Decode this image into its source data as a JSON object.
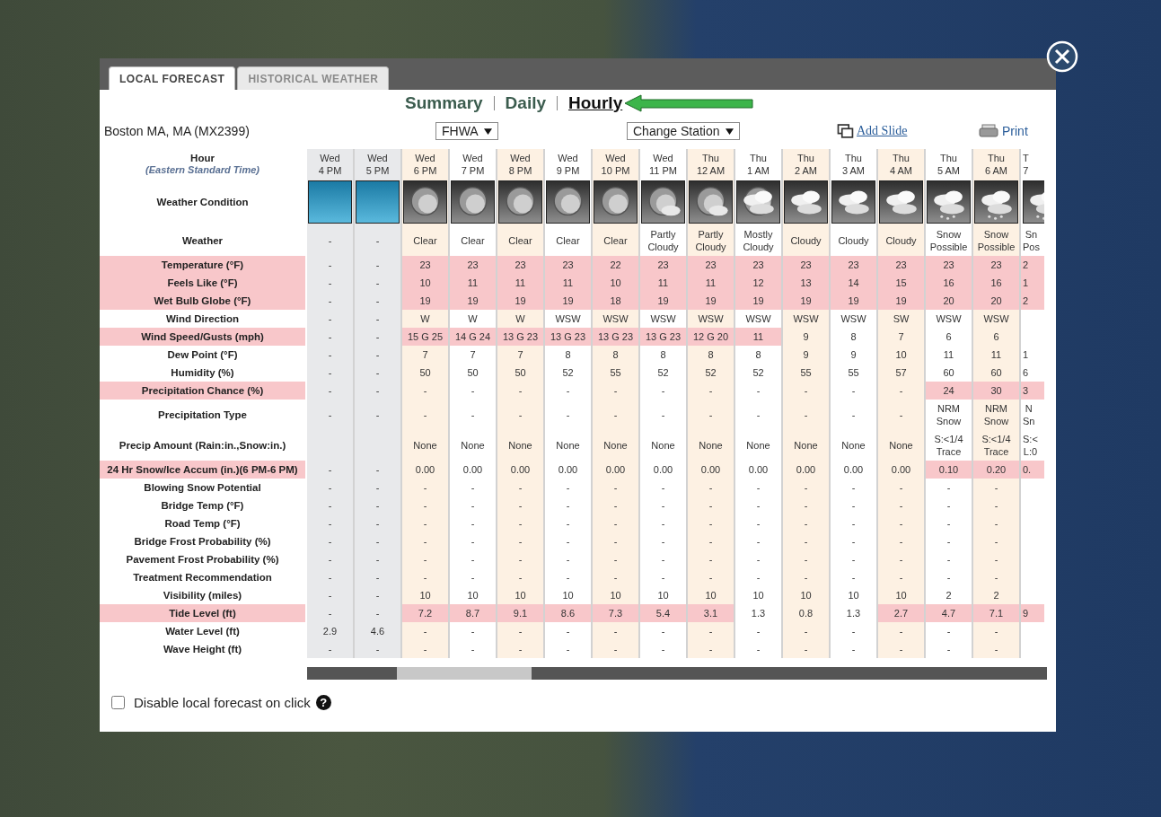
{
  "tabs": [
    {
      "label": "LOCAL FORECAST",
      "selected": true
    },
    {
      "label": "HISTORICAL WEATHER",
      "selected": false
    }
  ],
  "views": [
    {
      "label": "Summary",
      "selected": false
    },
    {
      "label": "Daily",
      "selected": false
    },
    {
      "label": "Hourly",
      "selected": true
    }
  ],
  "location": "Boston MA, MA (MX2399)",
  "source_select": {
    "value": "FHWA"
  },
  "station_select": {
    "value": "Change Station"
  },
  "add_slide": "Add Slide",
  "print": "Print",
  "table": {
    "hour_label": "Hour",
    "timezone": "(Eastern Standard Time)",
    "condition_label": "Weather Condition",
    "columns": [
      {
        "day": "Wed",
        "time": "4 PM",
        "kind": "observed"
      },
      {
        "day": "Wed",
        "time": "5 PM",
        "kind": "observed"
      },
      {
        "day": "Wed",
        "time": "6 PM",
        "kind": "clear"
      },
      {
        "day": "Wed",
        "time": "7 PM",
        "kind": "clear"
      },
      {
        "day": "Wed",
        "time": "8 PM",
        "kind": "clear"
      },
      {
        "day": "Wed",
        "time": "9 PM",
        "kind": "clear"
      },
      {
        "day": "Wed",
        "time": "10 PM",
        "kind": "clear"
      },
      {
        "day": "Wed",
        "time": "11 PM",
        "kind": "partlycloudy"
      },
      {
        "day": "Thu",
        "time": "12 AM",
        "kind": "partlycloudy"
      },
      {
        "day": "Thu",
        "time": "1 AM",
        "kind": "mostlycloudy"
      },
      {
        "day": "Thu",
        "time": "2 AM",
        "kind": "cloudy"
      },
      {
        "day": "Thu",
        "time": "3 AM",
        "kind": "cloudy"
      },
      {
        "day": "Thu",
        "time": "4 AM",
        "kind": "cloudy"
      },
      {
        "day": "Thu",
        "time": "5 AM",
        "kind": "snow"
      },
      {
        "day": "Thu",
        "time": "6 AM",
        "kind": "snow"
      },
      {
        "day": "T",
        "time": "7",
        "kind": "snow"
      }
    ],
    "rows": [
      {
        "label": "Weather",
        "alert": false,
        "cells": [
          "-",
          "-",
          "Clear",
          "Clear",
          "Clear",
          "Clear",
          "Clear",
          "Partly\nCloudy",
          "Partly\nCloudy",
          "Mostly\nCloudy",
          "Cloudy",
          "Cloudy",
          "Cloudy",
          "Snow\nPossible",
          "Snow\nPossible",
          "Sn\nPos"
        ]
      },
      {
        "label": "Temperature (°F)",
        "alert": true,
        "cells": [
          "-",
          "-",
          "23",
          "23",
          "23",
          "23",
          "22",
          "23",
          "23",
          "23",
          "23",
          "23",
          "23",
          "23",
          "23",
          "2"
        ],
        "alerts": [
          false,
          false,
          true,
          true,
          true,
          true,
          true,
          true,
          true,
          true,
          true,
          true,
          true,
          true,
          true,
          true
        ]
      },
      {
        "label": "Feels Like (°F)",
        "alert": true,
        "cells": [
          "-",
          "-",
          "10",
          "11",
          "11",
          "11",
          "10",
          "11",
          "11",
          "12",
          "13",
          "14",
          "15",
          "16",
          "16",
          "1"
        ],
        "alerts": [
          false,
          false,
          true,
          true,
          true,
          true,
          true,
          true,
          true,
          true,
          true,
          true,
          true,
          true,
          true,
          true
        ]
      },
      {
        "label": "Wet Bulb Globe (°F)",
        "alert": true,
        "cells": [
          "-",
          "-",
          "19",
          "19",
          "19",
          "19",
          "18",
          "19",
          "19",
          "19",
          "19",
          "19",
          "19",
          "20",
          "20",
          "2"
        ],
        "alerts": [
          false,
          false,
          true,
          true,
          true,
          true,
          true,
          true,
          true,
          true,
          true,
          true,
          true,
          true,
          true,
          true
        ]
      },
      {
        "label": "Wind Direction",
        "alert": false,
        "cells": [
          "-",
          "-",
          "W",
          "W",
          "W",
          "WSW",
          "WSW",
          "WSW",
          "WSW",
          "WSW",
          "WSW",
          "WSW",
          "SW",
          "WSW",
          "WSW",
          null
        ]
      },
      {
        "label": "Wind Speed/Gusts (mph)",
        "alert": true,
        "cells": [
          "-",
          "-",
          "15 G 25",
          "14 G 24",
          "13 G 23",
          "13 G 23",
          "13 G 23",
          "13 G 23",
          "12 G 20",
          "11",
          "9",
          "8",
          "7",
          "6",
          "6",
          null
        ],
        "alerts": [
          false,
          false,
          true,
          true,
          true,
          true,
          true,
          true,
          true,
          true,
          false,
          false,
          false,
          false,
          false,
          false
        ]
      },
      {
        "label": "Dew Point (°F)",
        "alert": false,
        "cells": [
          "-",
          "-",
          "7",
          "7",
          "7",
          "8",
          "8",
          "8",
          "8",
          "8",
          "9",
          "9",
          "10",
          "11",
          "11",
          "1"
        ]
      },
      {
        "label": "Humidity (%)",
        "alert": false,
        "cells": [
          "-",
          "-",
          "50",
          "50",
          "50",
          "52",
          "55",
          "52",
          "52",
          "52",
          "55",
          "55",
          "57",
          "60",
          "60",
          "6"
        ]
      },
      {
        "label": "Precipitation Chance (%)",
        "alert": true,
        "cells": [
          "-",
          "-",
          "-",
          "-",
          "-",
          "-",
          "-",
          "-",
          "-",
          "-",
          "-",
          "-",
          "-",
          "24",
          "30",
          "3"
        ],
        "alerts": [
          false,
          false,
          false,
          false,
          false,
          false,
          false,
          false,
          false,
          false,
          false,
          false,
          false,
          true,
          true,
          true
        ]
      },
      {
        "label": "Precipitation Type",
        "alert": false,
        "cells": [
          "-",
          "-",
          "-",
          "-",
          "-",
          "-",
          "-",
          "-",
          "-",
          "-",
          "-",
          "-",
          "-",
          "NRM\nSnow",
          "NRM\nSnow",
          "N\nSn"
        ]
      },
      {
        "label": "Precip Amount (Rain:in.,Snow:in.)",
        "alert": false,
        "cells": [
          null,
          null,
          "None",
          "None",
          "None",
          "None",
          "None",
          "None",
          "None",
          "None",
          "None",
          "None",
          "None",
          "S:<1/4\nTrace",
          "S:<1/4\nTrace",
          "S:<\nL:0"
        ]
      },
      {
        "label": "24 Hr Snow/Ice Accum (in.)(6 PM-6 PM)",
        "alert": true,
        "cells": [
          "-",
          "-",
          "0.00",
          "0.00",
          "0.00",
          "0.00",
          "0.00",
          "0.00",
          "0.00",
          "0.00",
          "0.00",
          "0.00",
          "0.00",
          "0.10",
          "0.20",
          "0."
        ],
        "alerts": [
          false,
          false,
          false,
          false,
          false,
          false,
          false,
          false,
          false,
          false,
          false,
          false,
          false,
          true,
          true,
          true
        ]
      },
      {
        "label": "Blowing Snow Potential",
        "alert": false,
        "cells": [
          "-",
          "-",
          "-",
          "-",
          "-",
          "-",
          "-",
          "-",
          "-",
          "-",
          "-",
          "-",
          "-",
          "-",
          "-",
          null
        ]
      },
      {
        "label": "Bridge Temp (°F)",
        "alert": false,
        "cells": [
          "-",
          "-",
          "-",
          "-",
          "-",
          "-",
          "-",
          "-",
          "-",
          "-",
          "-",
          "-",
          "-",
          "-",
          "-",
          null
        ]
      },
      {
        "label": "Road Temp (°F)",
        "alert": false,
        "cells": [
          "-",
          "-",
          "-",
          "-",
          "-",
          "-",
          "-",
          "-",
          "-",
          "-",
          "-",
          "-",
          "-",
          "-",
          "-",
          null
        ]
      },
      {
        "label": "Bridge Frost Probability (%)",
        "alert": false,
        "cells": [
          "-",
          "-",
          "-",
          "-",
          "-",
          "-",
          "-",
          "-",
          "-",
          "-",
          "-",
          "-",
          "-",
          "-",
          "-",
          null
        ]
      },
      {
        "label": "Pavement Frost Probability (%)",
        "alert": false,
        "cells": [
          "-",
          "-",
          "-",
          "-",
          "-",
          "-",
          "-",
          "-",
          "-",
          "-",
          "-",
          "-",
          "-",
          "-",
          "-",
          null
        ]
      },
      {
        "label": "Treatment Recommendation",
        "alert": false,
        "cells": [
          "-",
          "-",
          "-",
          "-",
          "-",
          "-",
          "-",
          "-",
          "-",
          "-",
          "-",
          "-",
          "-",
          "-",
          "-",
          null
        ]
      },
      {
        "label": "Visibility (miles)",
        "alert": false,
        "cells": [
          "-",
          "-",
          "10",
          "10",
          "10",
          "10",
          "10",
          "10",
          "10",
          "10",
          "10",
          "10",
          "10",
          "2",
          "2",
          null
        ]
      },
      {
        "label": "Tide Level (ft)",
        "alert": true,
        "cells": [
          "-",
          "-",
          "7.2",
          "8.7",
          "9.1",
          "8.6",
          "7.3",
          "5.4",
          "3.1",
          "1.3",
          "0.8",
          "1.3",
          "2.7",
          "4.7",
          "7.1",
          "9"
        ],
        "alerts": [
          false,
          false,
          true,
          true,
          true,
          true,
          true,
          true,
          true,
          false,
          false,
          false,
          true,
          true,
          true,
          true
        ]
      },
      {
        "label": "Water Level (ft)",
        "alert": false,
        "cells": [
          "2.9",
          "4.6",
          "-",
          "-",
          "-",
          "-",
          "-",
          "-",
          "-",
          "-",
          "-",
          "-",
          "-",
          "-",
          "-",
          null
        ]
      },
      {
        "label": "Wave Height (ft)",
        "alert": false,
        "cells": [
          "-",
          "-",
          "-",
          "-",
          "-",
          "-",
          "-",
          "-",
          "-",
          "-",
          "-",
          "-",
          "-",
          "-",
          "-",
          null
        ]
      }
    ]
  },
  "footer": {
    "checkbox_label": "Disable local forecast on click",
    "checked": false,
    "help": "?"
  }
}
